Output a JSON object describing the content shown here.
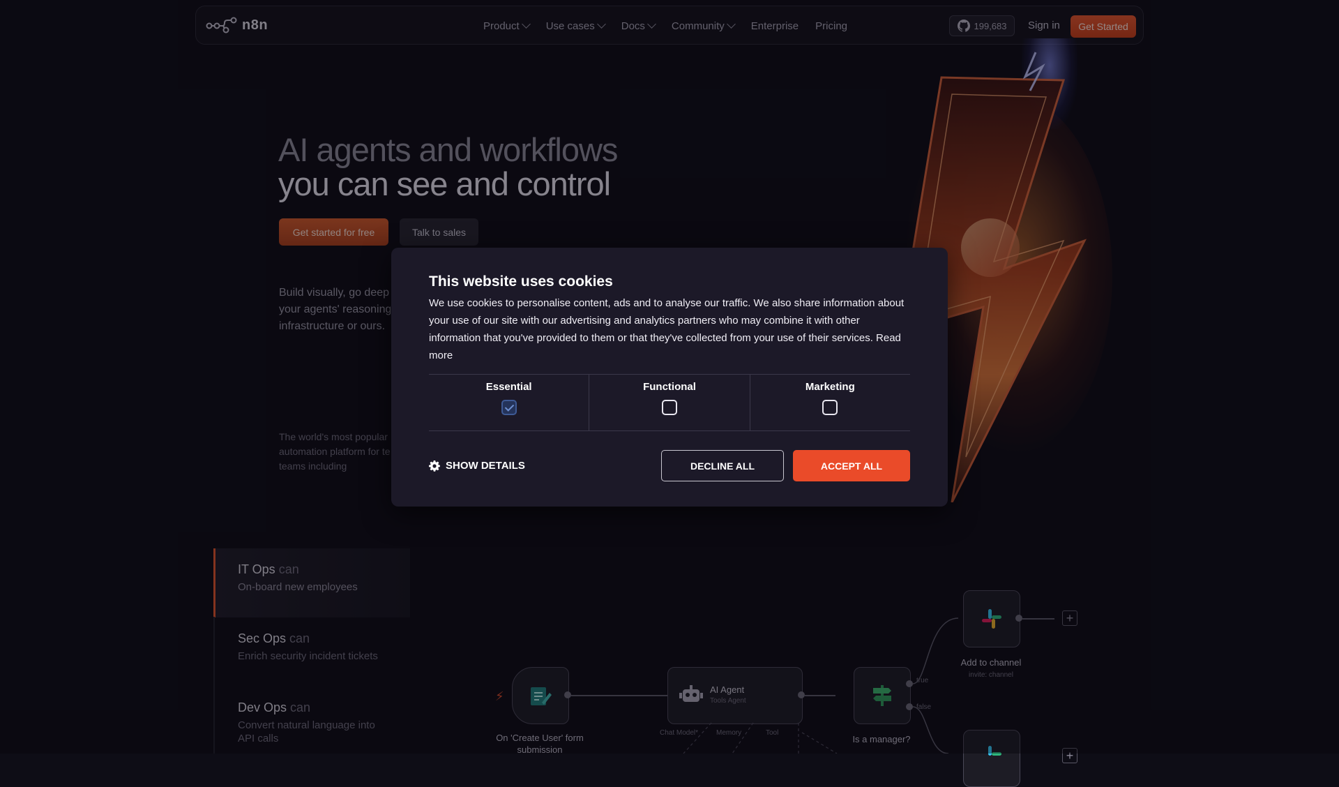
{
  "nav": {
    "logo_text": "n8n",
    "links": [
      {
        "label": "Product",
        "dropdown": true
      },
      {
        "label": "Use cases",
        "dropdown": true
      },
      {
        "label": "Docs",
        "dropdown": true
      },
      {
        "label": "Community",
        "dropdown": true
      },
      {
        "label": "Enterprise",
        "dropdown": false
      },
      {
        "label": "Pricing",
        "dropdown": false
      }
    ],
    "github_stars": "199,683",
    "sign_in": "Sign in",
    "get_started": "Get Started"
  },
  "hero": {
    "title_line1": "AI agents and workflows",
    "title_line2": "you can see and control",
    "cta_primary": "Get started for free",
    "cta_secondary": "Talk to sales",
    "description_lines": [
      "Build visually, go deep",
      "your agents' reasoning",
      "infrastructure or ours."
    ],
    "small_lines": [
      "The world's most popular",
      "automation platform for te",
      "teams including"
    ]
  },
  "use_cases": [
    {
      "team": "IT Ops",
      "can": "can",
      "task": "On-board new employees",
      "active": true
    },
    {
      "team": "Sec Ops",
      "can": "can",
      "task": "Enrich security incident tickets",
      "active": false
    },
    {
      "team": "Dev Ops",
      "can": "can",
      "task": "Convert natural language into",
      "task_line2": "API calls",
      "active": false
    }
  ],
  "workflow": {
    "trigger_label": "On 'Create User' form",
    "trigger_label2": "submission",
    "agent_title": "AI Agent",
    "agent_sub": "Tools Agent",
    "agent_ports": [
      "Chat Model*",
      "Memory",
      "Tool"
    ],
    "if_label": "Is a manager?",
    "if_true": "true",
    "if_false": "false",
    "slack_label": "Add to channel",
    "slack_sub": "invite: channel"
  },
  "cookie": {
    "title": "This website uses cookies",
    "body": "We use cookies to personalise content, ads and to analyse our traffic. We also share information about your use of our site with our advertising and analytics partners who may combine it with other information that you've provided to them or that they've collected from your use of their services. Read more",
    "categories": [
      {
        "label": "Essential",
        "checked": true
      },
      {
        "label": "Functional",
        "checked": false
      },
      {
        "label": "Marketing",
        "checked": false
      }
    ],
    "show_details": "SHOW DETAILS",
    "decline": "DECLINE ALL",
    "accept": "ACCEPT ALL"
  },
  "colors": {
    "accent": "#ea4b29",
    "background": "#0e0d16",
    "modal": "#1c1928"
  }
}
